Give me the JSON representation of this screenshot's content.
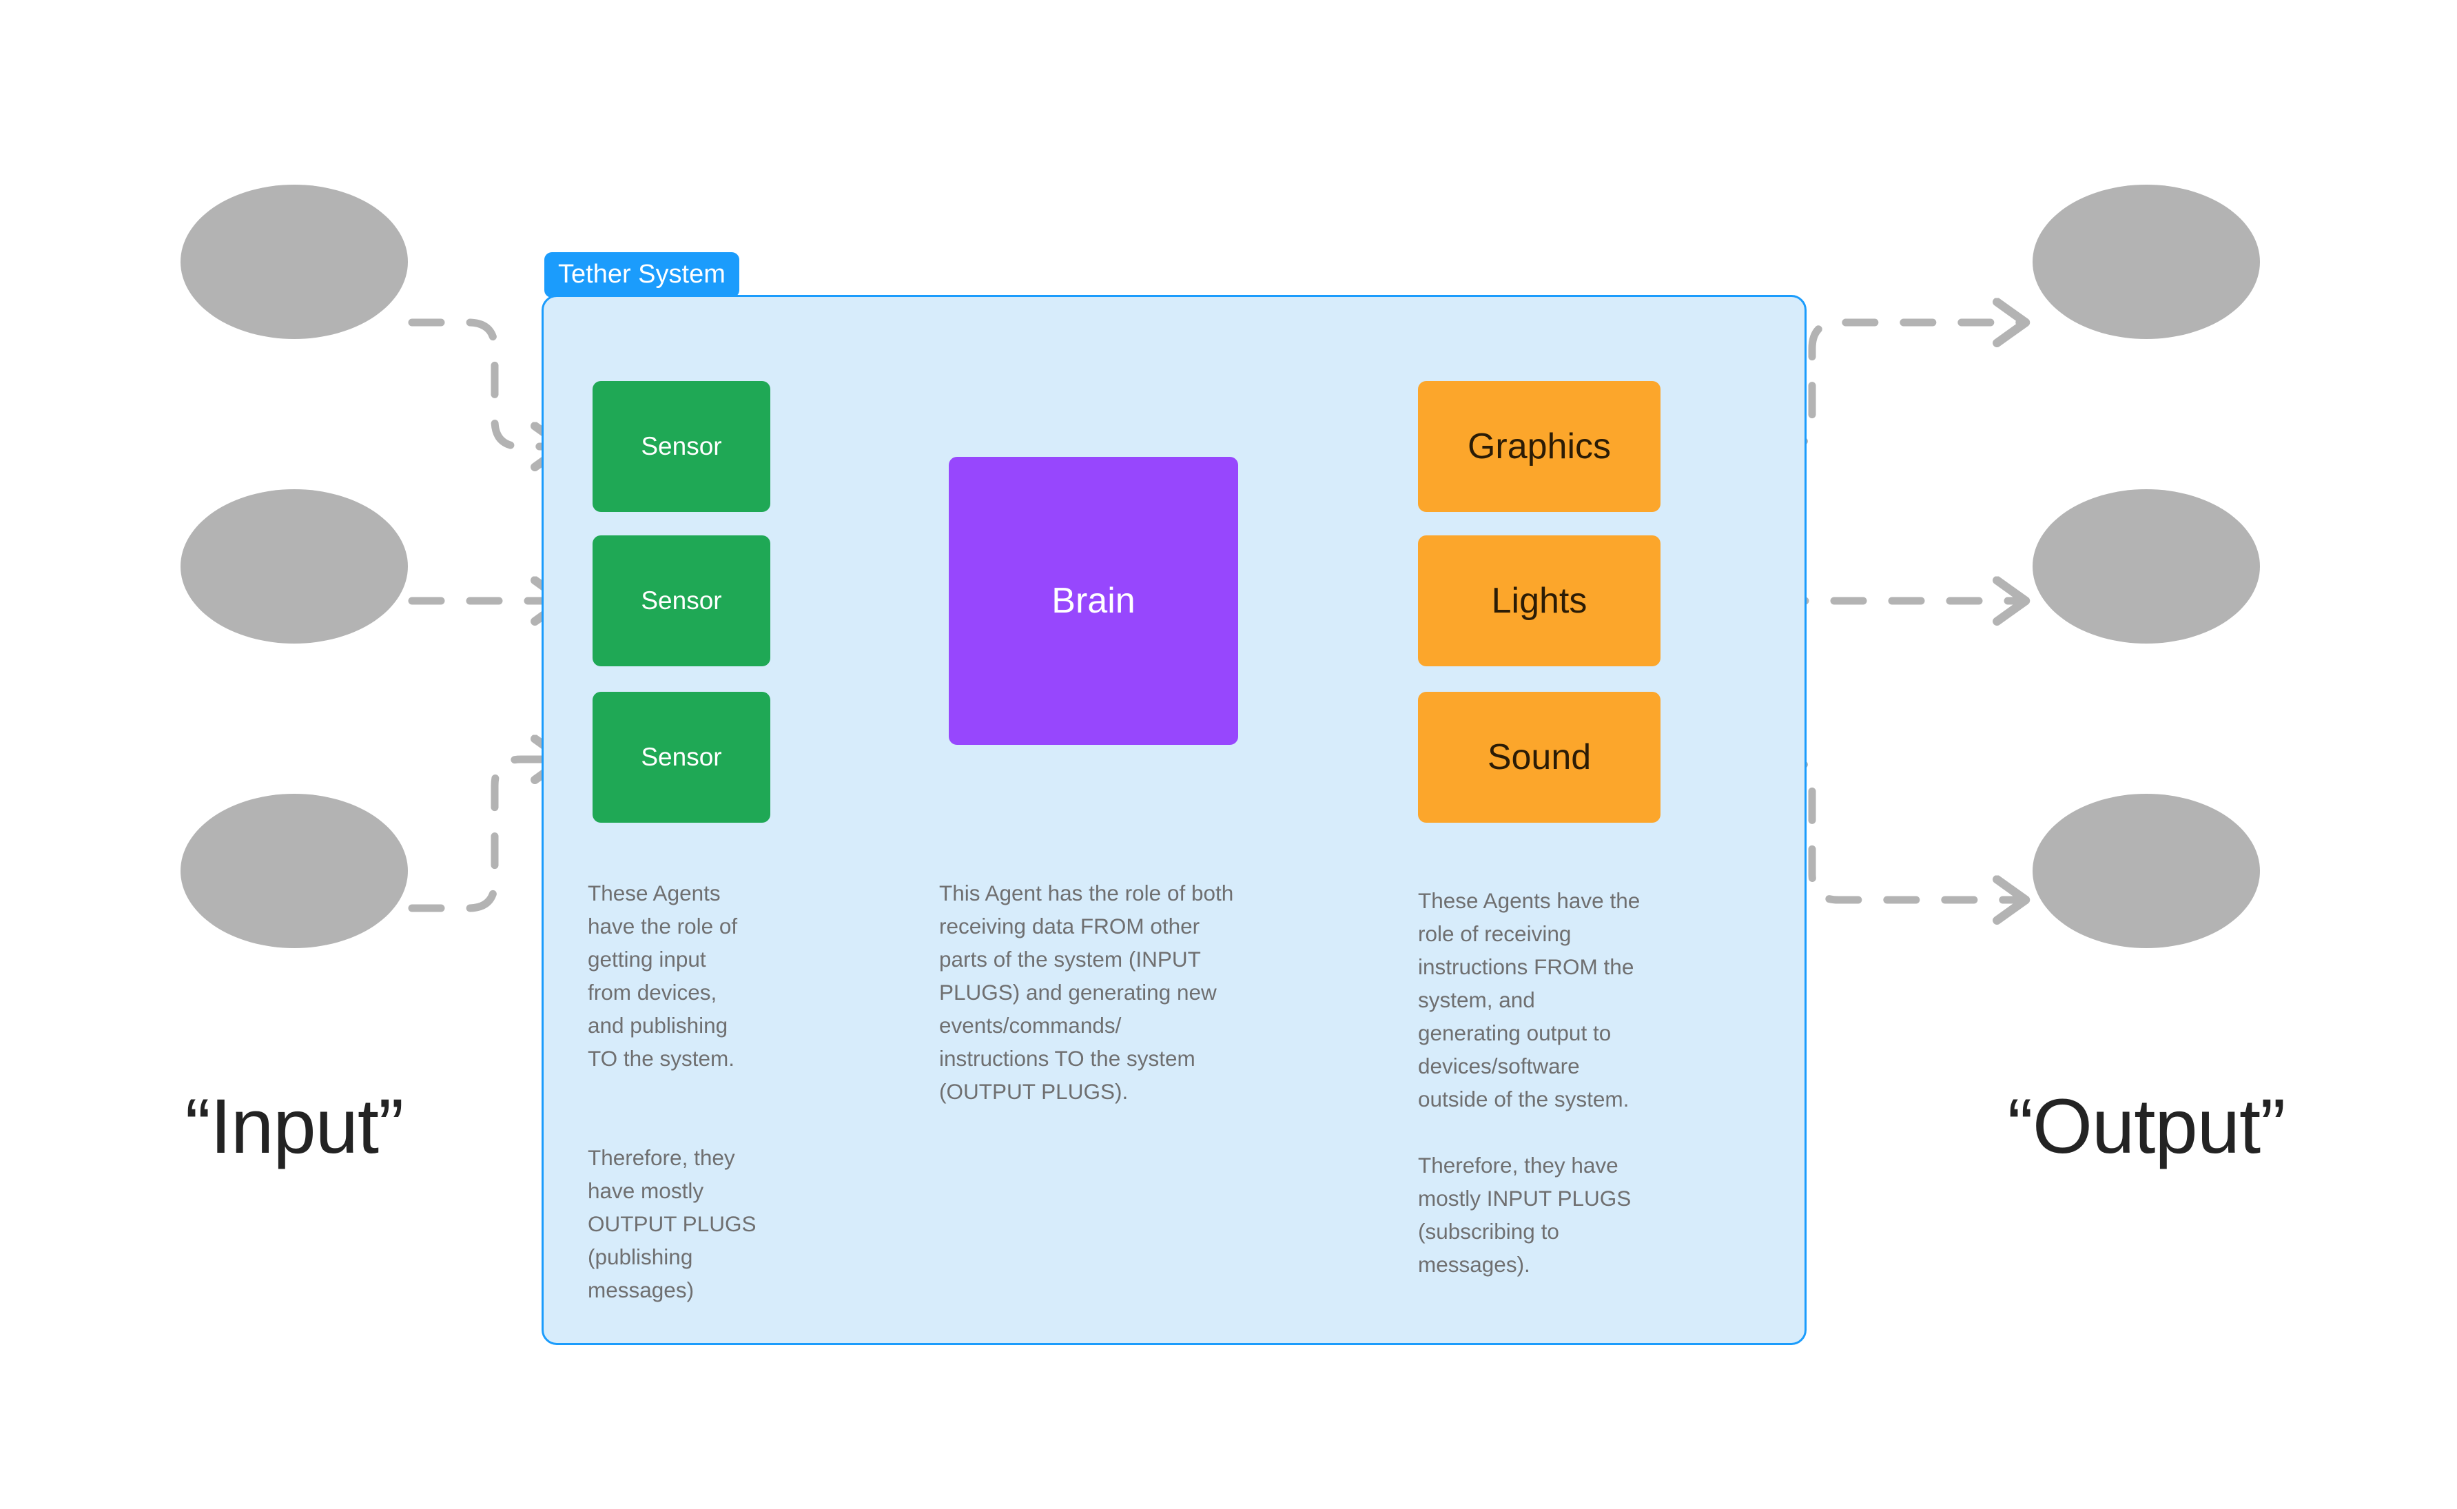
{
  "system": {
    "badge_label": "Tether System",
    "badge_color": "#1b9cfc",
    "container_fill": "#d7ecfb",
    "container_border": "#1b9cfc"
  },
  "side_labels": {
    "input": "“Input”",
    "output": "“Output”"
  },
  "colors": {
    "sensor": "#1fa855",
    "brain": "#9747fd",
    "output_node": "#fca62b",
    "external_circle": "#b3b3b3",
    "edge": "#b3b3b3",
    "body_text": "#6f6f70",
    "heading_text": "#232323"
  },
  "nodes": {
    "sensors": [
      {
        "label": "Sensor"
      },
      {
        "label": "Sensor"
      },
      {
        "label": "Sensor"
      }
    ],
    "brain": {
      "label": "Brain"
    },
    "outputs": [
      {
        "label": "Graphics"
      },
      {
        "label": "Lights"
      },
      {
        "label": "Sound"
      }
    ]
  },
  "descriptions": {
    "left": "These Agents\nhave the role of\ngetting input\nfrom devices,\nand publishing\nTO the system.\n\n\nTherefore, they\nhave mostly\nOUTPUT PLUGS\n(publishing\nmessages)",
    "middle": "This Agent has the role of both\nreceiving data FROM other\nparts of the system (INPUT\nPLUGS) and generating new\nevents/commands/\ninstructions TO the system\n(OUTPUT PLUGS).",
    "right": "These Agents have the\nrole of receiving\ninstructions FROM the\nsystem, and\ngenerating output to\ndevices/software\noutside of the system.\n\nTherefore, they have\nmostly INPUT PLUGS\n(subscribing to\nmessages)."
  },
  "external_circles": {
    "input": [
      {
        "name": "input-device-1"
      },
      {
        "name": "input-device-2"
      },
      {
        "name": "input-device-3"
      }
    ],
    "output": [
      {
        "name": "output-device-1"
      },
      {
        "name": "output-device-2"
      },
      {
        "name": "output-device-3"
      }
    ]
  },
  "edges": {
    "external_style": "dashed",
    "internal_style": "solid",
    "arrowheads": "open-chevron"
  }
}
